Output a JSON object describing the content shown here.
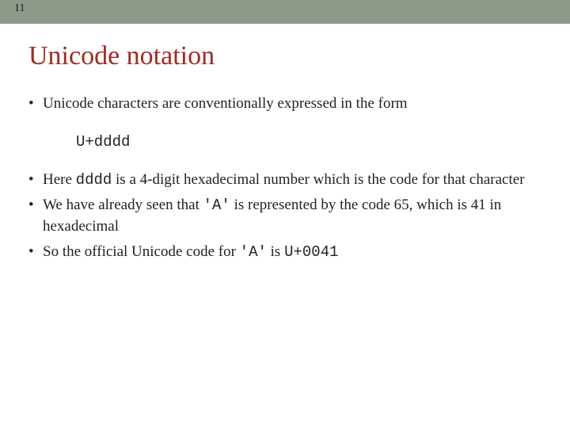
{
  "page_number": "11",
  "title": "Unicode notation",
  "bullets": {
    "b1": "Unicode characters are conventionally expressed in the form",
    "code_line": "U+dddd",
    "b2_pre": "Here ",
    "b2_mono": "dddd",
    "b2_post": " is a 4-digit hexadecimal number which is the code for that character",
    "b3_pre": "We have already seen that ",
    "b3_mono": "'A'",
    "b3_mid": " is  represented by the code 65, which is 41 in hexadecimal",
    "b4_pre": "So the official Unicode code for ",
    "b4_mono1": "'A'",
    "b4_mid": " is ",
    "b4_mono2": "U+0041"
  }
}
